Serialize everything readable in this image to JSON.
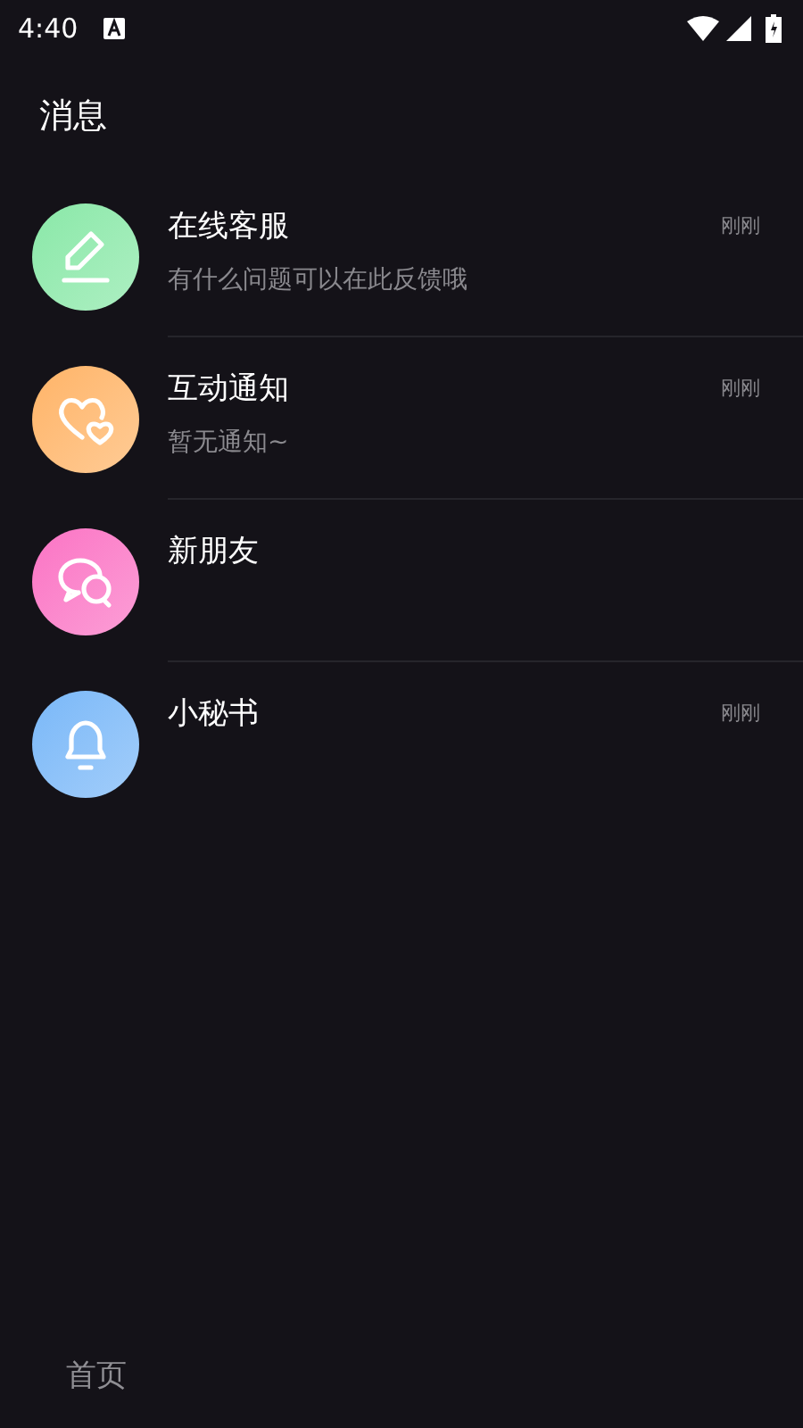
{
  "status_bar": {
    "time": "4:40"
  },
  "header": {
    "title": "消息"
  },
  "messages": [
    {
      "kind": "pencil",
      "color": "#8ae8a8",
      "title": "在线客服",
      "subtitle": "有什么问题可以在此反馈哦",
      "time": "刚刚"
    },
    {
      "kind": "hearts",
      "color": "#ffb468",
      "title": "互动通知",
      "subtitle": "暂无通知~",
      "time": "刚刚"
    },
    {
      "kind": "chat",
      "color": "#fb74c4",
      "title": "新朋友"
    },
    {
      "kind": "bell",
      "color": "#7ab8f8",
      "title": "小秘书",
      "time": "刚刚"
    }
  ],
  "bottom_nav": [
    {
      "label": "首页",
      "selected": false
    }
  ]
}
